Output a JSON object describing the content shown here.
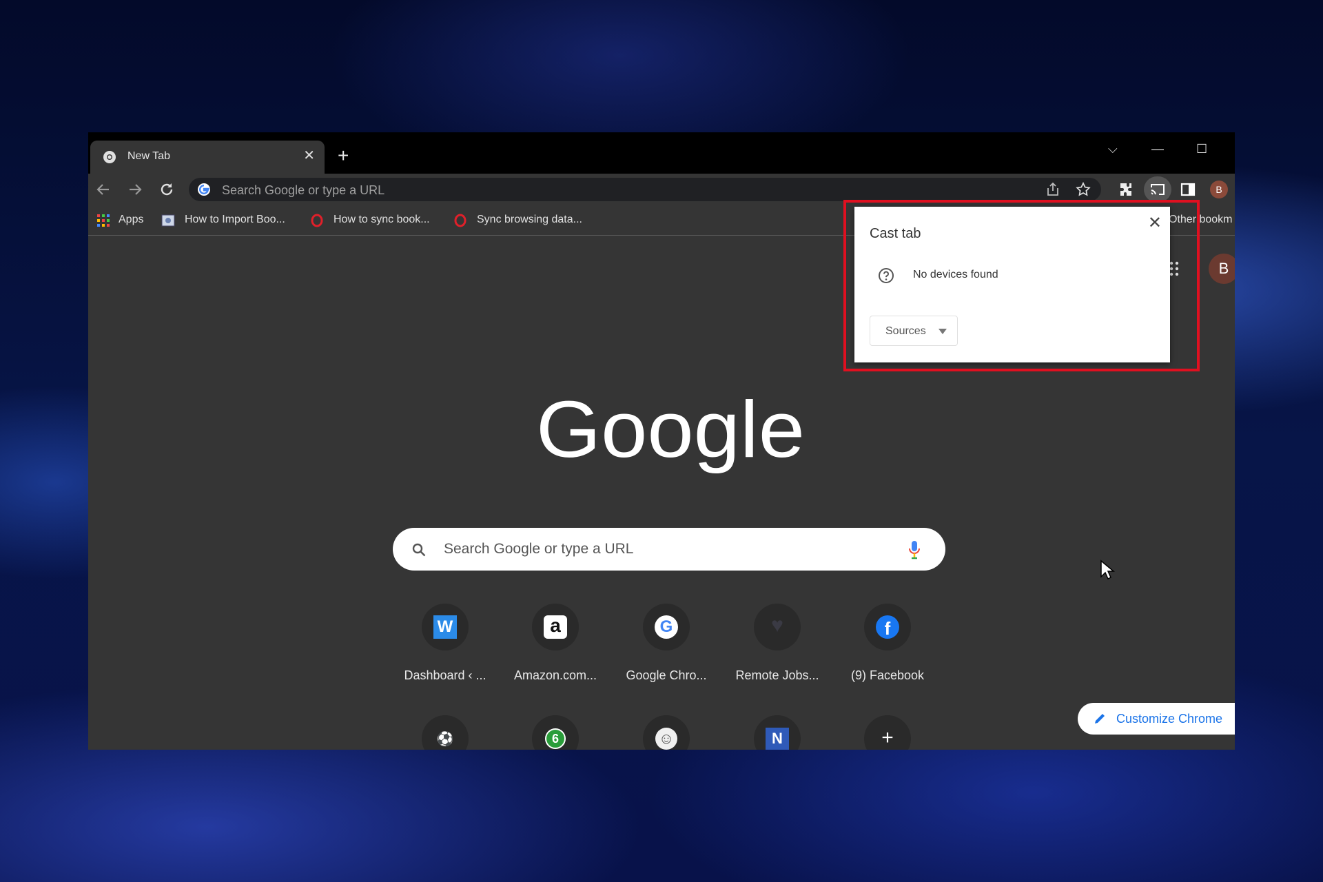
{
  "browser": {
    "tab": {
      "title": "New Tab",
      "close": "✕"
    },
    "new_tab": "+",
    "window_controls": {
      "dropdown": "⌵",
      "minimize": "—",
      "maximize": "☐"
    },
    "omnibox": {
      "placeholder": "Search Google or type a URL"
    },
    "profile_initial": "B"
  },
  "bookmarks": [
    {
      "label": "Apps"
    },
    {
      "label": "How to Import Boo..."
    },
    {
      "label": "How to sync book..."
    },
    {
      "label": "Sync browsing data..."
    },
    {
      "label": "Other bookm"
    }
  ],
  "newtab": {
    "logo": "Google",
    "search_placeholder": "Search Google or type a URL",
    "apps_profile_initial": "B",
    "shortcuts_row1": [
      {
        "label": "Dashboard ‹ ...",
        "glyph": "W"
      },
      {
        "label": "Amazon.com...",
        "glyph": "a"
      },
      {
        "label": "Google Chro...",
        "glyph": "G"
      },
      {
        "label": "Remote Jobs...",
        "glyph": "♥"
      },
      {
        "label": "(9) Facebook",
        "glyph": "f"
      }
    ],
    "shortcuts_row2": [
      {
        "glyph": "⚽"
      },
      {
        "glyph": "6"
      },
      {
        "glyph": "☺"
      },
      {
        "glyph": "N"
      },
      {
        "glyph": "+"
      }
    ],
    "customize": "Customize Chrome"
  },
  "cast_popup": {
    "title": "Cast tab",
    "close": "✕",
    "message": "No devices found",
    "sources": "Sources"
  },
  "colors": {
    "highlight": "#e01020",
    "accent": "#1a73e8"
  }
}
